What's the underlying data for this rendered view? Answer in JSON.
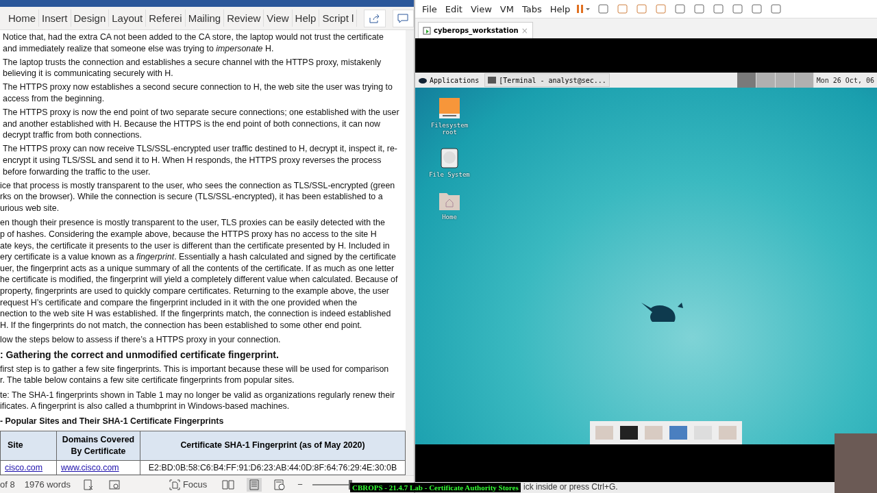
{
  "word": {
    "ribbon_tabs": [
      {
        "label": "Home",
        "selected": false
      },
      {
        "label": "Insert",
        "selected": false
      },
      {
        "label": "Design",
        "selected": false
      },
      {
        "label": "Layout",
        "selected": false
      },
      {
        "label": "Referei",
        "selected": false
      },
      {
        "label": "Mailing",
        "selected": false
      },
      {
        "label": "Review",
        "selected": false
      },
      {
        "label": "View",
        "selected": false
      },
      {
        "label": "Help",
        "selected": false
      },
      {
        "label": "Script l",
        "selected": false
      }
    ],
    "document": [
      {
        "kind": "para",
        "lines": [
          "Notice that, had the extra CA not been added to the CA store, the laptop would not trust the certificate",
          "and immediately realize that someone else was trying to *impersonate* H."
        ]
      },
      {
        "kind": "para",
        "lines": [
          "The laptop trusts the connection and establishes a secure channel with the HTTPS proxy, mistakenly",
          "believing it is communicating securely with H."
        ]
      },
      {
        "kind": "para",
        "lines": [
          "The HTTPS proxy now establishes a second secure connection to H, the web site the user was trying to",
          "access from the beginning."
        ]
      },
      {
        "kind": "para",
        "lines": [
          "The HTTPS proxy is now the end point of two separate secure connections; one established with the user",
          "and another established with H. Because the HTTPS is the end point of both connections, it can now",
          "decrypt traffic from both connections."
        ]
      },
      {
        "kind": "para",
        "lines": [
          "The HTTPS proxy can now receive TLS/SSL-encrypted user traffic destined to H, decrypt it, inspect it, re-",
          "encrypt it using TLS/SSL and send it to H. When H responds, the HTTPS proxy reverses the process",
          "before forwarding the traffic to the user."
        ]
      },
      {
        "kind": "cut",
        "lines": [
          "ice that process is mostly transparent to the user, who sees the connection as TLS/SSL-encrypted (green",
          "rks on the browser). While the connection is secure (TLS/SSL-encrypted), it has been established to a",
          "urious web site."
        ]
      },
      {
        "kind": "cut",
        "lines": [
          "en though their presence is mostly transparent to the user, TLS proxies can be easily detected with the",
          "p of hashes. Considering the example above, because the HTTPS proxy has no access to the site H",
          "ate keys, the certificate it presents to the user is different than the certificate presented by H. Included in",
          "ery certificate is a value known as a *fingerprint*. Essentially a hash calculated and signed by the certificate",
          "uer, the fingerprint acts as a unique summary of all the contents of the certificate. If as much as one letter",
          "he certificate is modified, the fingerprint will yield a completely different value when calculated. Because of",
          "property, fingerprints are used to quickly compare certificates. Returning to the example above, the user",
          "request H’s certificate and compare the fingerprint included in it with the one provided when the",
          "nection to the web site H was established. If the fingerprints match, the connection is indeed established",
          "H. If the fingerprints do not match, the connection has been established to some other end point."
        ]
      },
      {
        "kind": "cut",
        "lines": [
          "low the steps below to assess if there’s a HTTPS proxy in your connection."
        ]
      },
      {
        "kind": "heading",
        "lines": [
          ": Gathering the correct and unmodified certificate fingerprint."
        ]
      },
      {
        "kind": "cut",
        "lines": [
          "first step is to gather a few site fingerprints. This is important because these will be used for comparison",
          "r. The table below contains a few site certificate fingerprints from popular sites."
        ]
      },
      {
        "kind": "cut",
        "lines": [
          "te: The SHA-1 fingerprints shown in Table 1 may no longer be valid as organizations regularly renew their",
          "ificates. A fingerprint is also called a thumbprint in Windows-based machines."
        ]
      },
      {
        "kind": "caption",
        "lines": [
          " - Popular Sites and Their SHA-1 Certificate Fingerprints"
        ]
      }
    ],
    "table": {
      "columns": [
        "Site",
        "Domains Covered By Certificate",
        "Certificate SHA-1 Fingerprint (as of May 2020)"
      ],
      "rows": [
        [
          "cisco.com",
          "www.cisco.com",
          "E2:BD:0B:58:C6:B4:FF:91:D6:23:AB:44:0D:8F:64:76:29:4E:30:0B"
        ]
      ]
    },
    "status": {
      "page": "of 8",
      "words": "1976 words",
      "focus": "Focus",
      "zoom_out": "−",
      "zoom": {
        "level": 0.5
      }
    }
  },
  "vm": {
    "menu": [
      "File",
      "Edit",
      "View",
      "VM",
      "Tabs",
      "Help"
    ],
    "tab": "cyberops_workstation",
    "tab_close": "×",
    "panel": {
      "applications": "Applications",
      "task": "[Terminal - analyst@sec...",
      "workspaces": [
        {
          "selected": true
        },
        {
          "selected": false
        },
        {
          "selected": false
        },
        {
          "selected": false
        }
      ],
      "clock": "Mon 26 Oct, 06"
    },
    "desktop_icons": [
      {
        "kind": "drive",
        "label": "Filesystem root"
      },
      {
        "kind": "disk",
        "label": "File System"
      },
      {
        "kind": "home",
        "label": "Home"
      }
    ],
    "hint": "ick inside or press Ctrl+G."
  },
  "overlay_title": "CBROPS - 21.4.7 Lab - Certificate Authority Stores"
}
